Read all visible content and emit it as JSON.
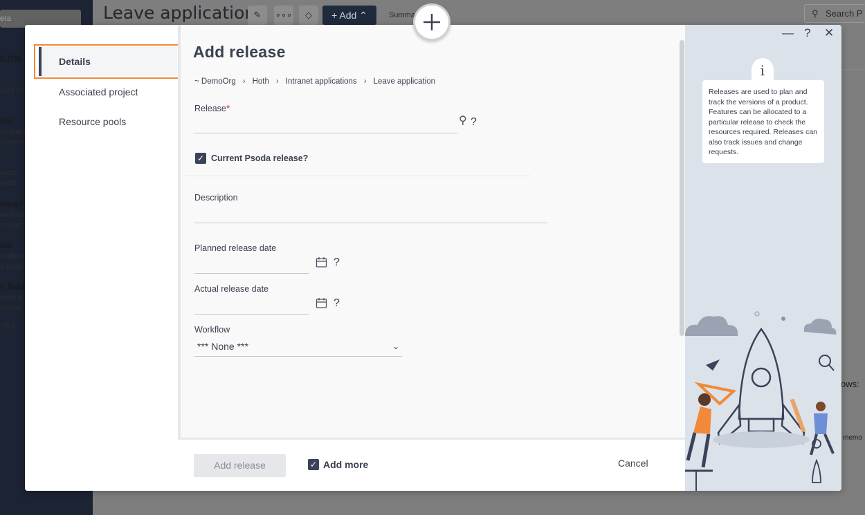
{
  "background": {
    "page_title": "Leave application",
    "add_label": "Add",
    "summary_label": "Summar",
    "search_placeholder": "Search P",
    "search_field_text": "era",
    "side_snippets": [
      {
        "title": "ILITIE",
        "lines": []
      },
      {
        "title": "",
        "lines": [
          "sers int"
        ]
      },
      {
        "title": "ent",
        "lines": [
          "ommen",
          "conversa"
        ]
      },
      {
        "title": "",
        "lines": [
          "custo",
          "exist"
        ]
      },
      {
        "title": "templ",
        "lines": [
          "se Psod",
          "ur own"
        ]
      },
      {
        "title": "ow",
        "lines": [
          "orkflow",
          "o most"
        ]
      },
      {
        "title": "n field",
        "lines": [
          "stom fi",
          "dozen"
        ]
      },
      {
        "title": "",
        "lines": [
          "ollce"
        ]
      }
    ],
    "rows_label": "ows:",
    "memo_label": "memo"
  },
  "dialog": {
    "nav": {
      "items": [
        {
          "label": "Details",
          "active": true
        },
        {
          "label": "Associated project",
          "active": false
        },
        {
          "label": "Resource pools",
          "active": false
        }
      ]
    },
    "form": {
      "title": "Add release",
      "breadcrumb": [
        "~ DemoOrg",
        "Hoth",
        "Intranet applications",
        "Leave application"
      ],
      "release_label": "Release",
      "release_value": "",
      "current_release_label": "Current Psoda release?",
      "current_release_checked": true,
      "description_label": "Description",
      "description_value": "",
      "planned_date_label": "Planned release date",
      "planned_date_value": "",
      "actual_date_label": "Actual release date",
      "actual_date_value": "",
      "workflow_label": "Workflow",
      "workflow_value": "*** None ***",
      "help_symbol": "?"
    },
    "footer": {
      "add_release_label": "Add release",
      "add_more_label": "Add more",
      "add_more_checked": true,
      "cancel_label": "Cancel"
    },
    "side": {
      "controls": {
        "minimize": "—",
        "help": "?",
        "close": "✕"
      },
      "info_icon": "i",
      "info_text": "Releases are used to plan and track the versions of a product. Features can be allocated to a particular release to check the resources required. Releases can also track issues and change requests."
    }
  },
  "colors": {
    "accent": "#3a4358",
    "highlight": "#f08a3a",
    "required": "#d0314a",
    "illustration_orange": "#f08a3a",
    "illustration_blue": "#6d8fd6"
  }
}
